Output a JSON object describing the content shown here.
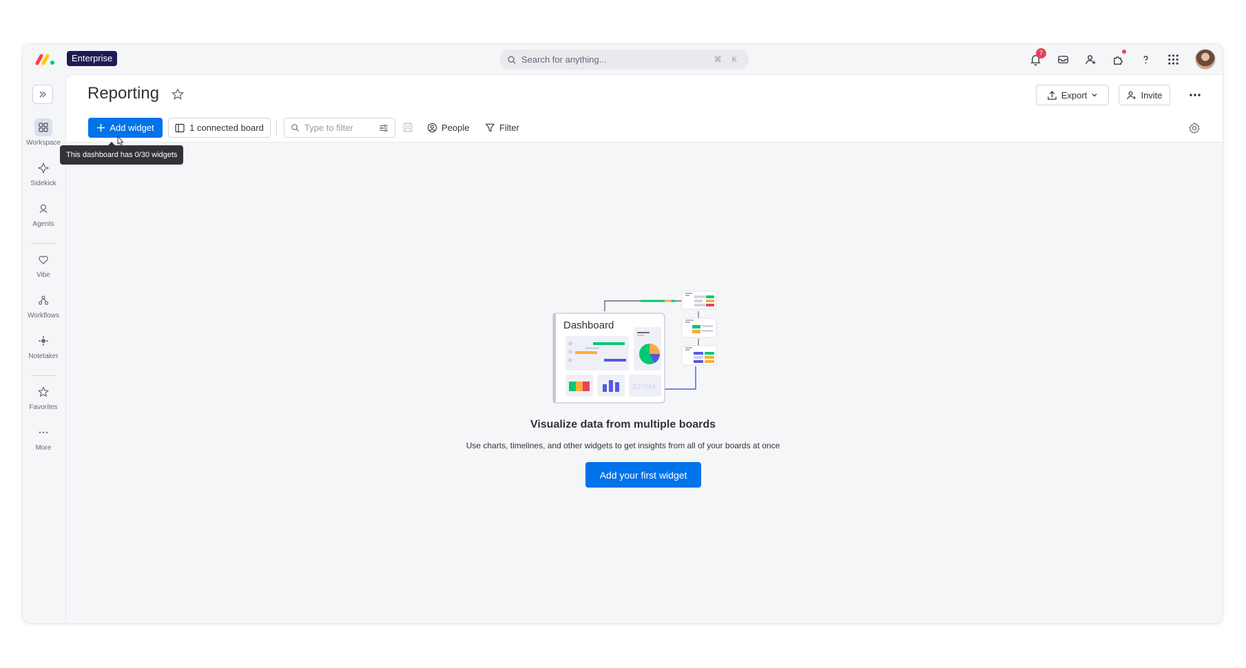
{
  "topbar": {
    "badge": "Enterprise",
    "search_placeholder": "Search for anything...",
    "search_shortcut": "⌘ K",
    "notification_count": "7"
  },
  "rail": {
    "items": [
      {
        "label": "Workspace",
        "icon": "grid-icon"
      },
      {
        "label": "Sidekick",
        "icon": "sparkle-icon"
      },
      {
        "label": "Agents",
        "icon": "agent-icon"
      },
      {
        "label": "Vibe",
        "icon": "heart-icon"
      },
      {
        "label": "Workflows",
        "icon": "workflow-icon"
      },
      {
        "label": "Notetaker",
        "icon": "notetaker-icon"
      },
      {
        "label": "Favorites",
        "icon": "star-icon"
      },
      {
        "label": "More",
        "icon": "more-icon"
      }
    ]
  },
  "header": {
    "title": "Reporting",
    "export_label": "Export",
    "invite_label": "Invite"
  },
  "toolbar": {
    "add_widget_label": "Add widget",
    "connected_label": "1 connected board",
    "filter_placeholder": "Type to filter",
    "people_label": "People",
    "filter_label": "Filter"
  },
  "tooltip": {
    "text": "This dashboard has 0/30 widgets"
  },
  "empty_state": {
    "illustration_title": "Dashboard",
    "illustration_value": "$375M",
    "title": "Visualize data from multiple boards",
    "description": "Use charts, timelines, and other widgets to get insights from all of your boards at once",
    "cta_label": "Add your first widget"
  },
  "colors": {
    "primary": "#0073ea",
    "badge_bg": "#1f1c55",
    "danger": "#e2445c",
    "green": "#00c875",
    "yellow": "#fdab3d",
    "purple": "#5559df"
  }
}
